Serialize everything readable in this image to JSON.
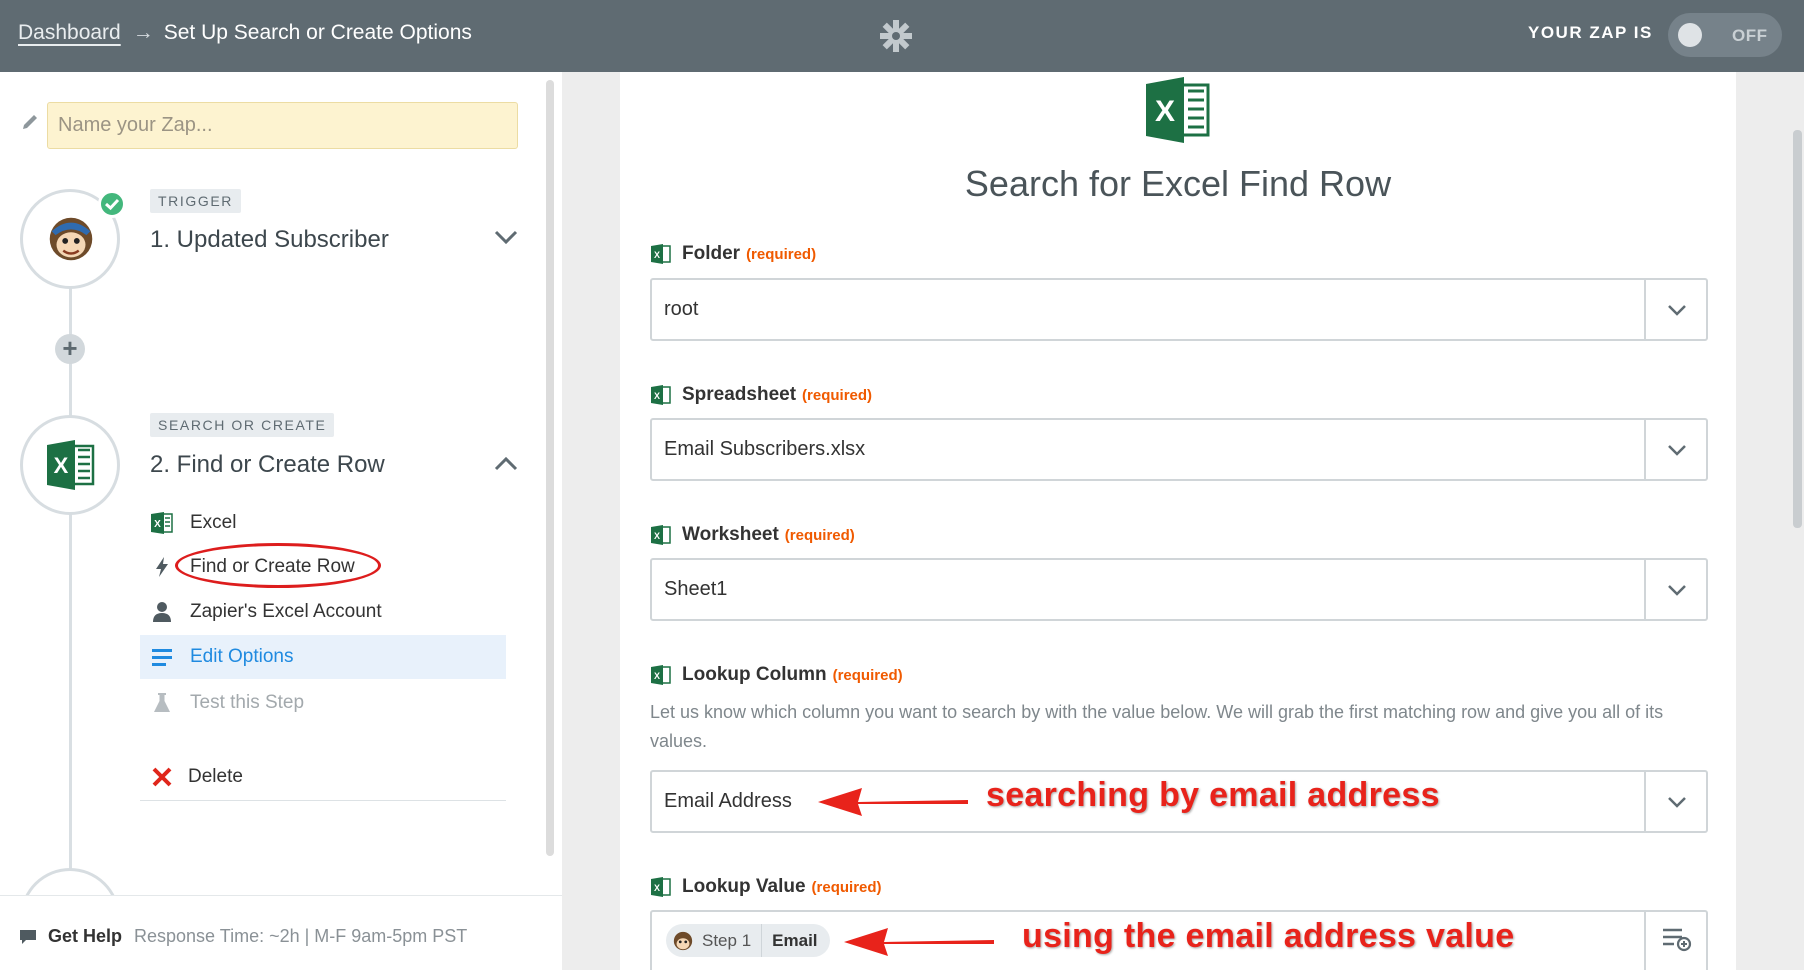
{
  "header": {
    "breadcrumb_link": "Dashboard",
    "breadcrumb_arrow": "→",
    "breadcrumb_current": "Set Up Search or Create Options",
    "zap_status_label": "YOUR ZAP IS",
    "toggle_label": "OFF",
    "colors": {
      "bar": "#5f6b72"
    }
  },
  "sidebar": {
    "zap_name_placeholder": "Name your Zap...",
    "trigger": {
      "tag": "TRIGGER",
      "title": "1. Updated Subscriber",
      "icon": "mailchimp-icon",
      "completed": true
    },
    "add_step": "+",
    "action": {
      "tag": "SEARCH OR CREATE",
      "title": "2. Find or Create Row",
      "icon": "excel-icon",
      "items": [
        {
          "label": "Excel",
          "icon": "excel-icon"
        },
        {
          "label": "Find or Create Row",
          "icon": "lightning-icon",
          "highlighted": true
        },
        {
          "label": "Zapier's Excel Account",
          "icon": "user-icon"
        },
        {
          "label": "Edit Options",
          "icon": "list-icon",
          "active": true
        },
        {
          "label": "Test this Step",
          "icon": "flask-icon",
          "disabled": true
        }
      ],
      "delete_label": "Delete"
    },
    "help": {
      "label": "Get Help",
      "response": "Response Time: ~2h | M-F 9am-5pm PST"
    }
  },
  "main": {
    "title": "Search for Excel Find Row",
    "required_text": "(required)",
    "fields": [
      {
        "label": "Folder",
        "value": "root"
      },
      {
        "label": "Spreadsheet",
        "value": "Email Subscribers.xlsx"
      },
      {
        "label": "Worksheet",
        "value": "Sheet1"
      },
      {
        "label": "Lookup Column",
        "value": "Email Address",
        "help": "Let us know which column you want to search by with the value below. We will grab the first matching row and give you all of its values."
      },
      {
        "label": "Lookup Value",
        "pill_step": "Step 1",
        "pill_field": "Email"
      }
    ],
    "annotations": {
      "lookup_column": "searching by email address",
      "lookup_value": "using the email address value"
    },
    "colors": {
      "required": "#f05a00",
      "annotation": "#e8231b",
      "excel": "#1d7044"
    }
  }
}
